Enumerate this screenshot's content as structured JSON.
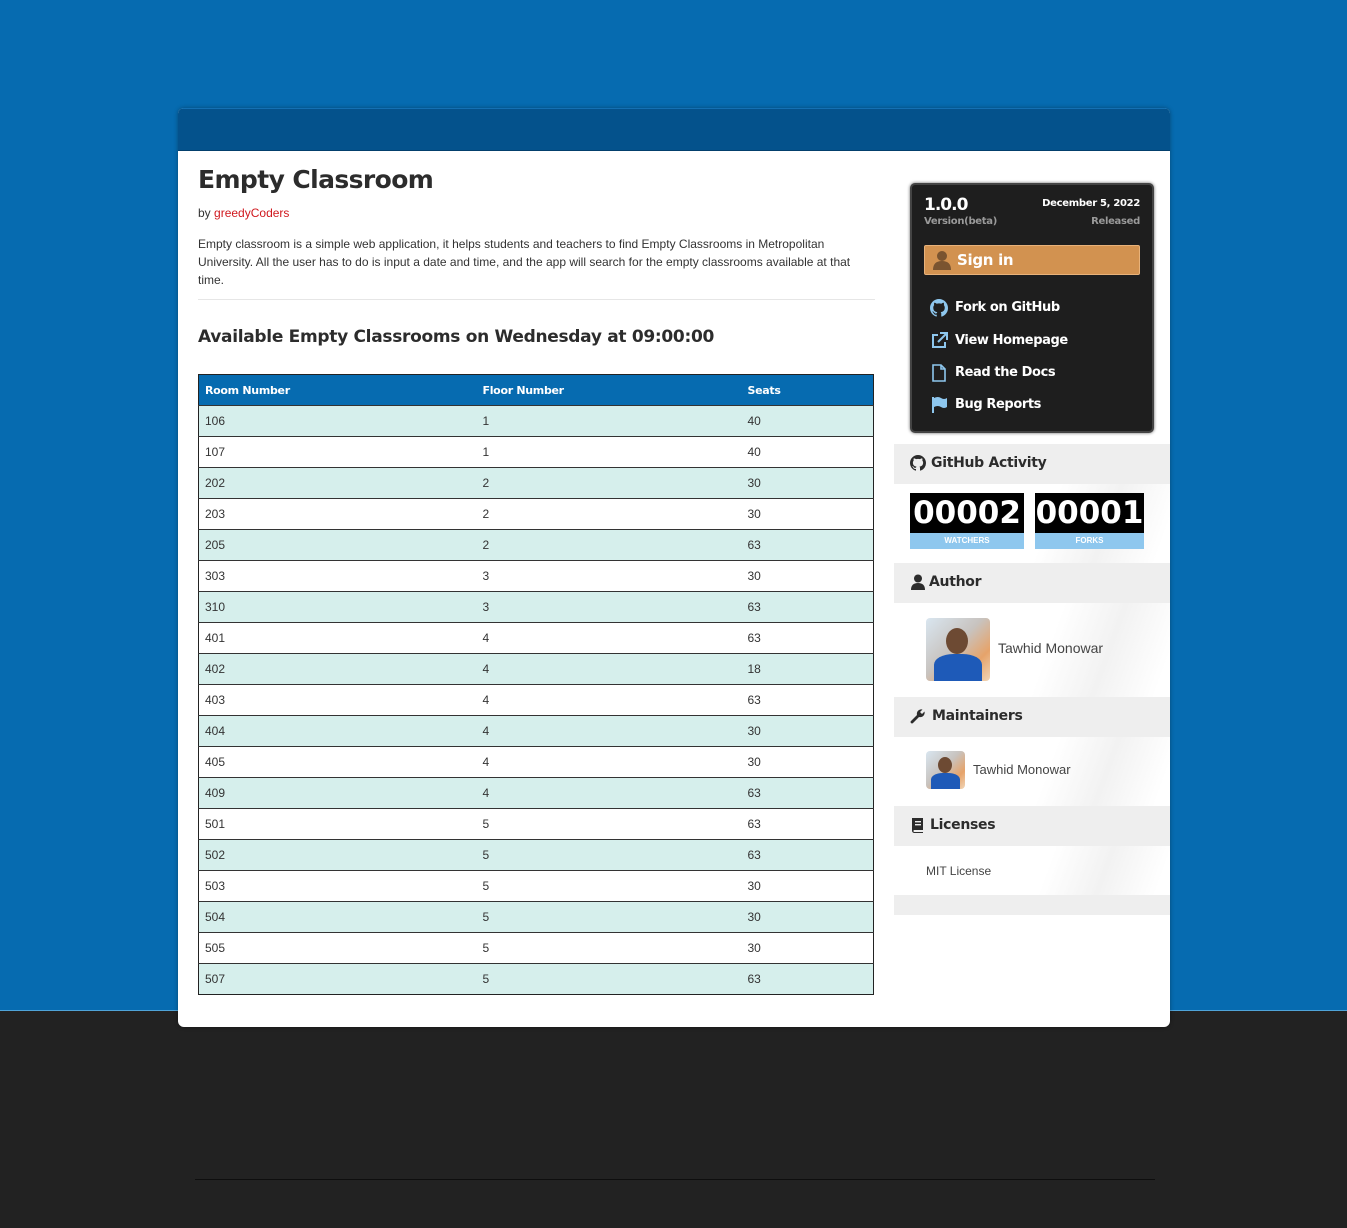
{
  "project": {
    "title": "Empty Classroom",
    "by_prefix": "by",
    "owner": "greedyCoders",
    "description": "Empty classroom is a simple web application, it helps students and teachers to find Empty Classrooms in Metropolitan University. All the user has to do is input a date and time, and the app will search for the empty classrooms available at that time."
  },
  "results": {
    "heading": "Available Empty Classrooms on Wednesday at 09:00:00",
    "columns": [
      "Room Number",
      "Floor Number",
      "Seats"
    ],
    "rows": [
      [
        "106",
        "1",
        "40"
      ],
      [
        "107",
        "1",
        "40"
      ],
      [
        "202",
        "2",
        "30"
      ],
      [
        "203",
        "2",
        "30"
      ],
      [
        "205",
        "2",
        "63"
      ],
      [
        "303",
        "3",
        "30"
      ],
      [
        "310",
        "3",
        "63"
      ],
      [
        "401",
        "4",
        "63"
      ],
      [
        "402",
        "4",
        "18"
      ],
      [
        "403",
        "4",
        "63"
      ],
      [
        "404",
        "4",
        "30"
      ],
      [
        "405",
        "4",
        "30"
      ],
      [
        "409",
        "4",
        "63"
      ],
      [
        "501",
        "5",
        "63"
      ],
      [
        "502",
        "5",
        "63"
      ],
      [
        "503",
        "5",
        "30"
      ],
      [
        "504",
        "5",
        "30"
      ],
      [
        "505",
        "5",
        "30"
      ],
      [
        "507",
        "5",
        "63"
      ]
    ]
  },
  "release": {
    "version": "1.0.0",
    "version_label": "Version(beta)",
    "date": "December 5, 2022",
    "date_label": "Released",
    "signin_label": "Sign in",
    "links": [
      {
        "label": "Fork on GitHub",
        "icon": "github-icon"
      },
      {
        "label": "View Homepage",
        "icon": "external-link-icon"
      },
      {
        "label": "Read the Docs",
        "icon": "document-icon"
      },
      {
        "label": "Bug Reports",
        "icon": "flag-icon"
      }
    ]
  },
  "github_activity": {
    "heading": "GitHub Activity",
    "watchers": "00002",
    "watchers_label": "WATCHERS",
    "forks": "00001",
    "forks_label": "FORKS"
  },
  "author": {
    "heading": "Author",
    "name": "Tawhid Monowar"
  },
  "maintainers": {
    "heading": "Maintainers",
    "items": [
      {
        "name": "Tawhid Monowar"
      }
    ]
  },
  "licenses": {
    "heading": "Licenses",
    "items": [
      {
        "label": "MIT License"
      }
    ]
  },
  "colors": {
    "brand_blue": "#066bb0",
    "header_bar": "#04528c",
    "signin_orange": "#d29250",
    "owner_link_red": "#d0181e",
    "row_tint": "#d6efec",
    "counter_caption": "#8ec7ee"
  }
}
